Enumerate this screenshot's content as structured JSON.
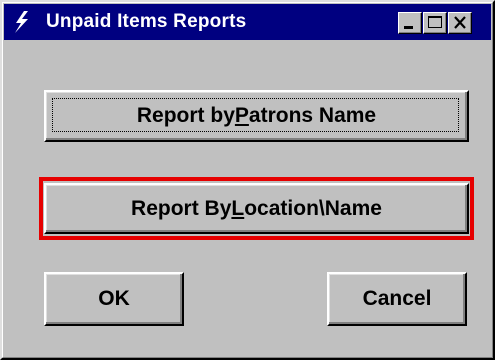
{
  "window": {
    "title": "Unpaid Items Reports",
    "icon": "lightning-bolt-icon",
    "controls": {
      "minimize": "minimize-icon",
      "maximize": "maximize-icon",
      "close": "close-icon"
    }
  },
  "buttons": {
    "patrons": {
      "before": "Report by ",
      "mnemonic": "P",
      "after": "atrons Name"
    },
    "location": {
      "before": "Report By ",
      "mnemonic": "L",
      "after": "ocation\\Name"
    },
    "ok": "OK",
    "cancel": "Cancel"
  },
  "colors": {
    "face": "#c0c0c0",
    "titlebar": "#000080",
    "highlight": "#e60000"
  }
}
